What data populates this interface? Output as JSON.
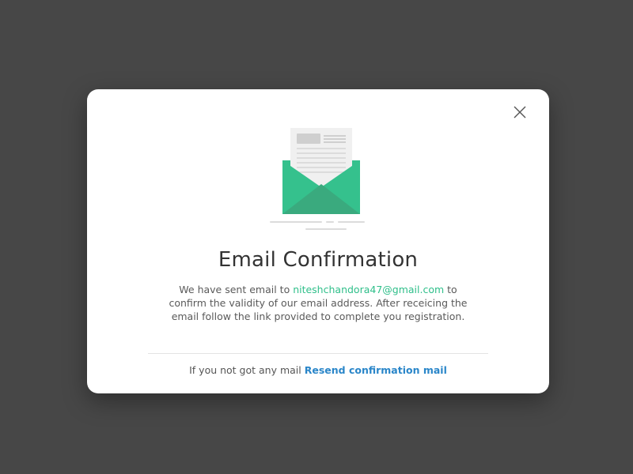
{
  "modal": {
    "title": "Email Confirmation",
    "message_before": "We have sent email to ",
    "email": "niteshchandora47@gmail.com",
    "message_after": "  to confirm the validity  of our email address. After receicing the email follow the link provided to complete you registration.",
    "footer_text": "If you not got any mail ",
    "resend_label": "Resend confirmation mail",
    "close_icon": "close-icon",
    "illustration_icon": "open-envelope-icon"
  },
  "colors": {
    "backdrop": "#474747",
    "envelope": "#35c18d",
    "email_link": "#2fbf8a",
    "resend_link": "#2a86c9",
    "title": "#333333"
  }
}
